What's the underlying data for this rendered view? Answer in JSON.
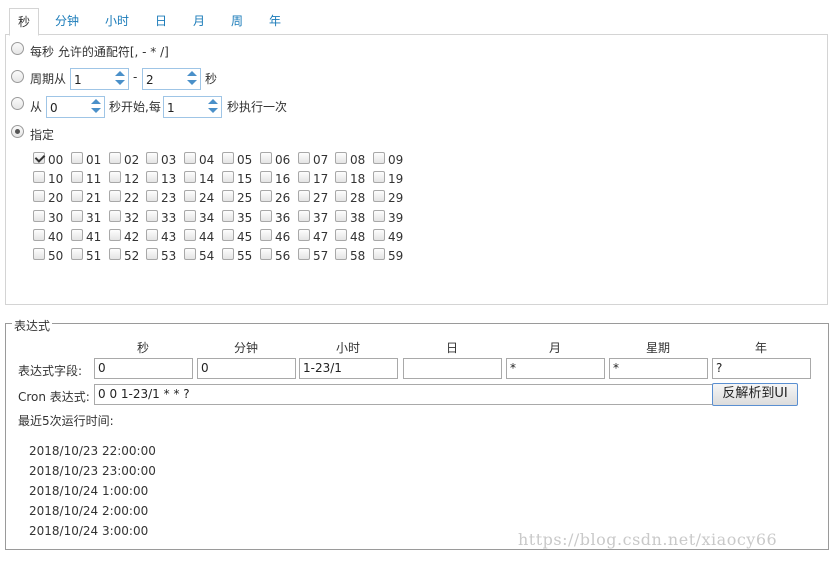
{
  "tabs": [
    {
      "label": "秒",
      "active": true
    },
    {
      "label": "分钟",
      "active": false
    },
    {
      "label": "小时",
      "active": false
    },
    {
      "label": "日",
      "active": false
    },
    {
      "label": "月",
      "active": false
    },
    {
      "label": "周",
      "active": false
    },
    {
      "label": "年",
      "active": false
    }
  ],
  "second_panel": {
    "option_every": {
      "label": "每秒 允许的通配符[, - * /]",
      "selected": false
    },
    "option_cycle": {
      "label_prefix": "周期从",
      "from": "1",
      "dash": "-",
      "to": "2",
      "label_suffix": "秒",
      "selected": false
    },
    "option_start": {
      "label_prefix": "从",
      "start": "0",
      "label_mid": "秒开始,每",
      "every": "1",
      "label_suffix": "秒执行一次",
      "selected": false
    },
    "option_specify": {
      "label": "指定",
      "selected": true
    },
    "checkboxes": [
      {
        "label": "00",
        "checked": true
      },
      {
        "label": "01",
        "checked": false
      },
      {
        "label": "02",
        "checked": false
      },
      {
        "label": "03",
        "checked": false
      },
      {
        "label": "04",
        "checked": false
      },
      {
        "label": "05",
        "checked": false
      },
      {
        "label": "06",
        "checked": false
      },
      {
        "label": "07",
        "checked": false
      },
      {
        "label": "08",
        "checked": false
      },
      {
        "label": "09",
        "checked": false
      },
      {
        "label": "10",
        "checked": false
      },
      {
        "label": "11",
        "checked": false
      },
      {
        "label": "12",
        "checked": false
      },
      {
        "label": "13",
        "checked": false
      },
      {
        "label": "14",
        "checked": false
      },
      {
        "label": "15",
        "checked": false
      },
      {
        "label": "16",
        "checked": false
      },
      {
        "label": "17",
        "checked": false
      },
      {
        "label": "18",
        "checked": false
      },
      {
        "label": "19",
        "checked": false
      },
      {
        "label": "20",
        "checked": false
      },
      {
        "label": "21",
        "checked": false
      },
      {
        "label": "22",
        "checked": false
      },
      {
        "label": "23",
        "checked": false
      },
      {
        "label": "24",
        "checked": false
      },
      {
        "label": "25",
        "checked": false
      },
      {
        "label": "26",
        "checked": false
      },
      {
        "label": "27",
        "checked": false
      },
      {
        "label": "28",
        "checked": false
      },
      {
        "label": "29",
        "checked": false
      },
      {
        "label": "30",
        "checked": false
      },
      {
        "label": "31",
        "checked": false
      },
      {
        "label": "32",
        "checked": false
      },
      {
        "label": "33",
        "checked": false
      },
      {
        "label": "34",
        "checked": false
      },
      {
        "label": "35",
        "checked": false
      },
      {
        "label": "36",
        "checked": false
      },
      {
        "label": "37",
        "checked": false
      },
      {
        "label": "38",
        "checked": false
      },
      {
        "label": "39",
        "checked": false
      },
      {
        "label": "40",
        "checked": false
      },
      {
        "label": "41",
        "checked": false
      },
      {
        "label": "42",
        "checked": false
      },
      {
        "label": "43",
        "checked": false
      },
      {
        "label": "44",
        "checked": false
      },
      {
        "label": "45",
        "checked": false
      },
      {
        "label": "46",
        "checked": false
      },
      {
        "label": "47",
        "checked": false
      },
      {
        "label": "48",
        "checked": false
      },
      {
        "label": "49",
        "checked": false
      },
      {
        "label": "50",
        "checked": false
      },
      {
        "label": "51",
        "checked": false
      },
      {
        "label": "52",
        "checked": false
      },
      {
        "label": "53",
        "checked": false
      },
      {
        "label": "54",
        "checked": false
      },
      {
        "label": "55",
        "checked": false
      },
      {
        "label": "56",
        "checked": false
      },
      {
        "label": "57",
        "checked": false
      },
      {
        "label": "58",
        "checked": false
      },
      {
        "label": "59",
        "checked": false
      }
    ]
  },
  "expression": {
    "legend": "表达式",
    "columns": [
      "秒",
      "分钟",
      "小时",
      "日",
      "月",
      "星期",
      "年"
    ],
    "fields_label": "表达式字段:",
    "fields": [
      "0",
      "0",
      "1-23/1",
      "",
      "*",
      "*",
      "?"
    ],
    "cron_label": "Cron 表达式:",
    "cron_value": "0 0 1-23/1  * * ?",
    "reverse_button": "反解析到UI",
    "recent_label": "最近5次运行时间:",
    "recent_runs": [
      "2018/10/23 22:00:00",
      "2018/10/23 23:00:00",
      "2018/10/24 1:00:00",
      "2018/10/24 2:00:00",
      "2018/10/24 3:00:00"
    ]
  },
  "watermark": "https://blog.csdn.net/xiaocy66"
}
